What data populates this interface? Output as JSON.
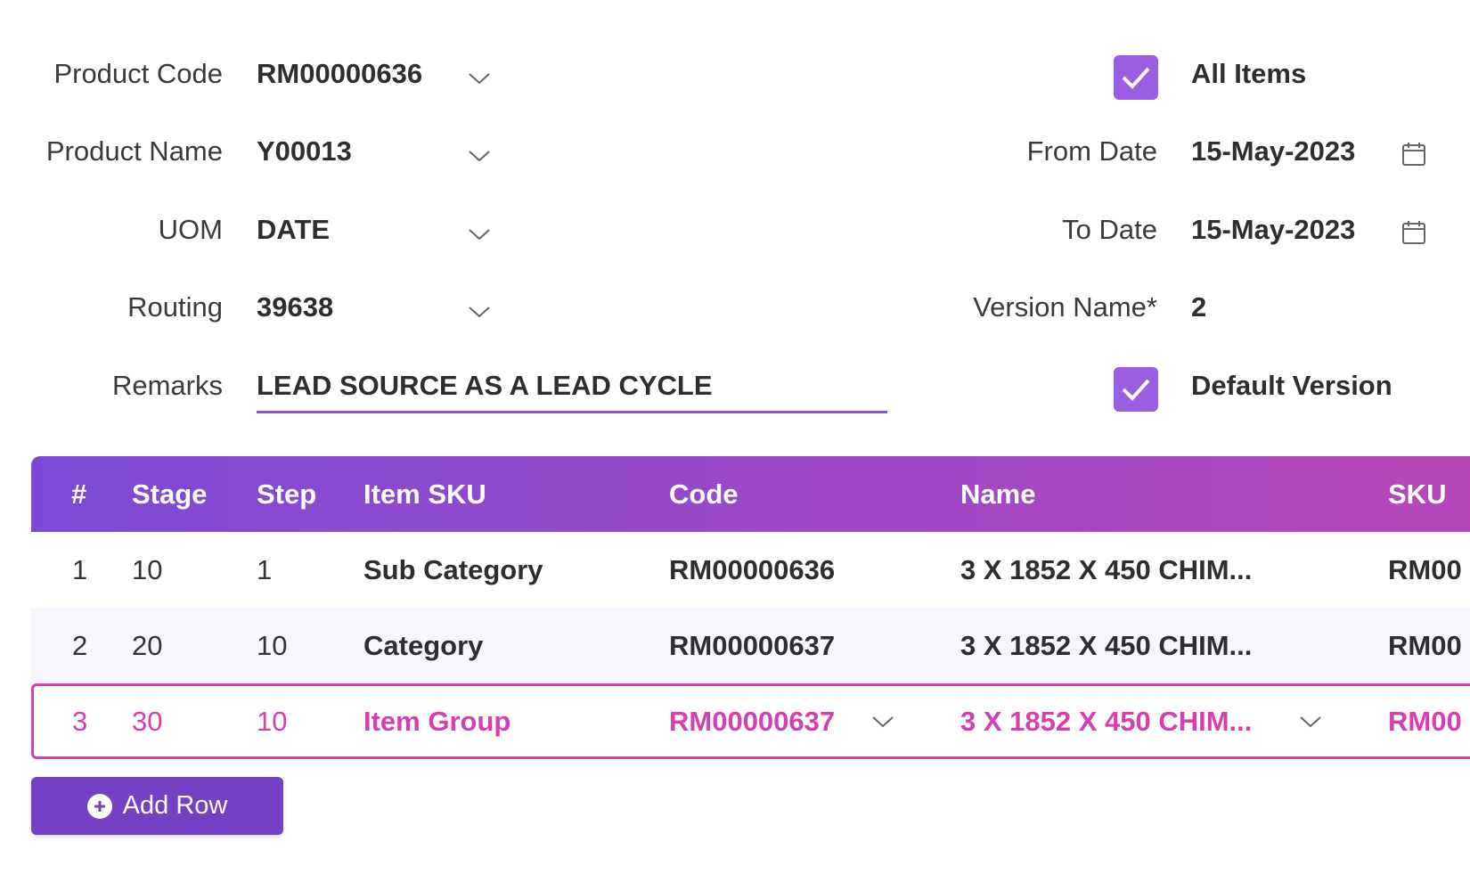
{
  "form": {
    "product_code": {
      "label": "Product Code",
      "value": "RM00000636"
    },
    "product_name": {
      "label": "Product Name",
      "value": "Y00013"
    },
    "uom": {
      "label": "UOM",
      "value": "DATE"
    },
    "routing": {
      "label": "Routing",
      "value": "39638"
    },
    "remarks": {
      "label": "Remarks",
      "value": "LEAD SOURCE AS A LEAD CYCLE"
    },
    "all_items": {
      "label": "All Items",
      "checked": true
    },
    "from_date": {
      "label": "From Date",
      "value": "15-May-2023"
    },
    "to_date": {
      "label": "To Date",
      "value": "15-May-2023"
    },
    "version_name": {
      "label": "Version Name*",
      "value": "2"
    },
    "default_version": {
      "label": "Default Version",
      "checked": true
    }
  },
  "table": {
    "headers": [
      "#",
      "Stage",
      "Step",
      "Item SKU",
      "Code",
      "Name",
      "SKU"
    ],
    "rows": [
      {
        "num": "1",
        "stage": "10",
        "step": "1",
        "item_sku": "Sub Category",
        "code": "RM00000636",
        "name": "3 X 1852 X 450 CHIM...",
        "sku": "RM00"
      },
      {
        "num": "2",
        "stage": "20",
        "step": "10",
        "item_sku": "Category",
        "code": "RM00000637",
        "name": "3 X 1852 X 450 CHIM...",
        "sku": "RM00"
      },
      {
        "num": "3",
        "stage": "30",
        "step": "10",
        "item_sku": "Item Group",
        "code": "RM00000637",
        "name": "3 X 1852 X 450 CHIM...",
        "sku": "RM00",
        "selected": true
      }
    ]
  },
  "actions": {
    "add_row_label": "Add Row"
  },
  "colors": {
    "accent": "#9a5fe0",
    "selected_row": "#d63fb0",
    "button": "#7541c4"
  }
}
